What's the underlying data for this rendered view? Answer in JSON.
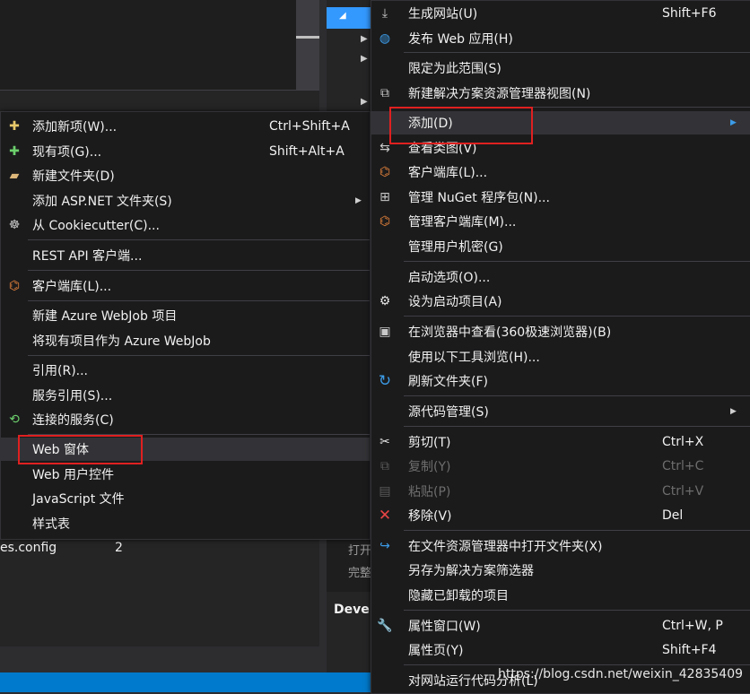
{
  "background": {
    "config_file": "es.config",
    "config_count": "2",
    "output_line_1": "打开",
    "output_line_2": "完整",
    "panel_label": "Deve"
  },
  "left_menu": {
    "items": [
      {
        "label": "添加新项(W)...",
        "shortcut": "Ctrl+Shift+A",
        "icon": "add-item-icon"
      },
      {
        "label": "现有项(G)...",
        "shortcut": "Shift+Alt+A",
        "icon": "existing-item-icon"
      },
      {
        "label": "新建文件夹(D)",
        "shortcut": "",
        "icon": "new-folder-icon"
      },
      {
        "label": "添加 ASP.NET 文件夹(S)",
        "shortcut": "",
        "icon": ""
      },
      {
        "label": "从 Cookiecutter(C)...",
        "shortcut": "",
        "icon": "cookiecutter-icon"
      },
      {
        "label": "REST API 客户端...",
        "shortcut": "",
        "icon": ""
      },
      {
        "label": "客户端库(L)...",
        "shortcut": "",
        "icon": "client-library-icon"
      },
      {
        "label": "新建 Azure WebJob 项目",
        "shortcut": "",
        "icon": ""
      },
      {
        "label": "将现有项目作为 Azure WebJob",
        "shortcut": "",
        "icon": ""
      },
      {
        "label": "引用(R)...",
        "shortcut": "",
        "icon": ""
      },
      {
        "label": "服务引用(S)...",
        "shortcut": "",
        "icon": ""
      },
      {
        "label": "连接的服务(C)",
        "shortcut": "",
        "icon": "connected-service-icon"
      },
      {
        "label": "Web 窗体",
        "shortcut": "",
        "icon": ""
      },
      {
        "label": "Web 用户控件",
        "shortcut": "",
        "icon": ""
      },
      {
        "label": "JavaScript 文件",
        "shortcut": "",
        "icon": ""
      },
      {
        "label": "样式表",
        "shortcut": "",
        "icon": ""
      }
    ]
  },
  "right_menu": {
    "items": [
      {
        "label": "生成网站(U)",
        "shortcut": "Shift+F6",
        "icon": "build-icon"
      },
      {
        "label": "发布 Web 应用(H)",
        "shortcut": "",
        "icon": "globe-icon"
      },
      {
        "label": "限定为此范围(S)",
        "shortcut": "",
        "icon": ""
      },
      {
        "label": "新建解决方案资源管理器视图(N)",
        "shortcut": "",
        "icon": "new-view-icon"
      },
      {
        "label": "添加(D)",
        "shortcut": "",
        "icon": ""
      },
      {
        "label": "查看类图(V)",
        "shortcut": "",
        "icon": "class-diagram-icon"
      },
      {
        "label": "客户端库(L)...",
        "shortcut": "",
        "icon": "client-library-icon"
      },
      {
        "label": "管理 NuGet 程序包(N)...",
        "shortcut": "",
        "icon": "nuget-icon"
      },
      {
        "label": "管理客户端库(M)...",
        "shortcut": "",
        "icon": "client-library-icon"
      },
      {
        "label": "管理用户机密(G)",
        "shortcut": "",
        "icon": ""
      },
      {
        "label": "启动选项(O)...",
        "shortcut": "",
        "icon": ""
      },
      {
        "label": "设为启动项目(A)",
        "shortcut": "",
        "icon": "gear-icon"
      },
      {
        "label": "在浏览器中查看(360极速浏览器)(B)",
        "shortcut": "",
        "icon": "browser-icon"
      },
      {
        "label": "使用以下工具浏览(H)...",
        "shortcut": "",
        "icon": ""
      },
      {
        "label": "刷新文件夹(F)",
        "shortcut": "",
        "icon": "refresh-icon"
      },
      {
        "label": "源代码管理(S)",
        "shortcut": "",
        "icon": ""
      },
      {
        "label": "剪切(T)",
        "shortcut": "Ctrl+X",
        "icon": "scissors-icon"
      },
      {
        "label": "复制(Y)",
        "shortcut": "Ctrl+C",
        "icon": "copy-icon"
      },
      {
        "label": "粘贴(P)",
        "shortcut": "Ctrl+V",
        "icon": "paste-icon"
      },
      {
        "label": "移除(V)",
        "shortcut": "Del",
        "icon": "remove-icon"
      },
      {
        "label": "在文件资源管理器中打开文件夹(X)",
        "shortcut": "",
        "icon": "open-folder-icon"
      },
      {
        "label": "另存为解决方案筛选器",
        "shortcut": "",
        "icon": ""
      },
      {
        "label": "隐藏已卸载的项目",
        "shortcut": "",
        "icon": ""
      },
      {
        "label": "属性窗口(W)",
        "shortcut": "Ctrl+W, P",
        "icon": "wrench-icon"
      },
      {
        "label": "属性页(Y)",
        "shortcut": "Shift+F4",
        "icon": ""
      },
      {
        "label": "对网站运行代码分析(L)",
        "shortcut": "",
        "icon": ""
      }
    ]
  },
  "watermark": "https://blog.csdn.net/weixin_42835409",
  "colors": {
    "menu_bg": "#1b1b1c",
    "highlight": "#333337",
    "annotation_red": "#e02020",
    "status_blue": "#007acc"
  }
}
